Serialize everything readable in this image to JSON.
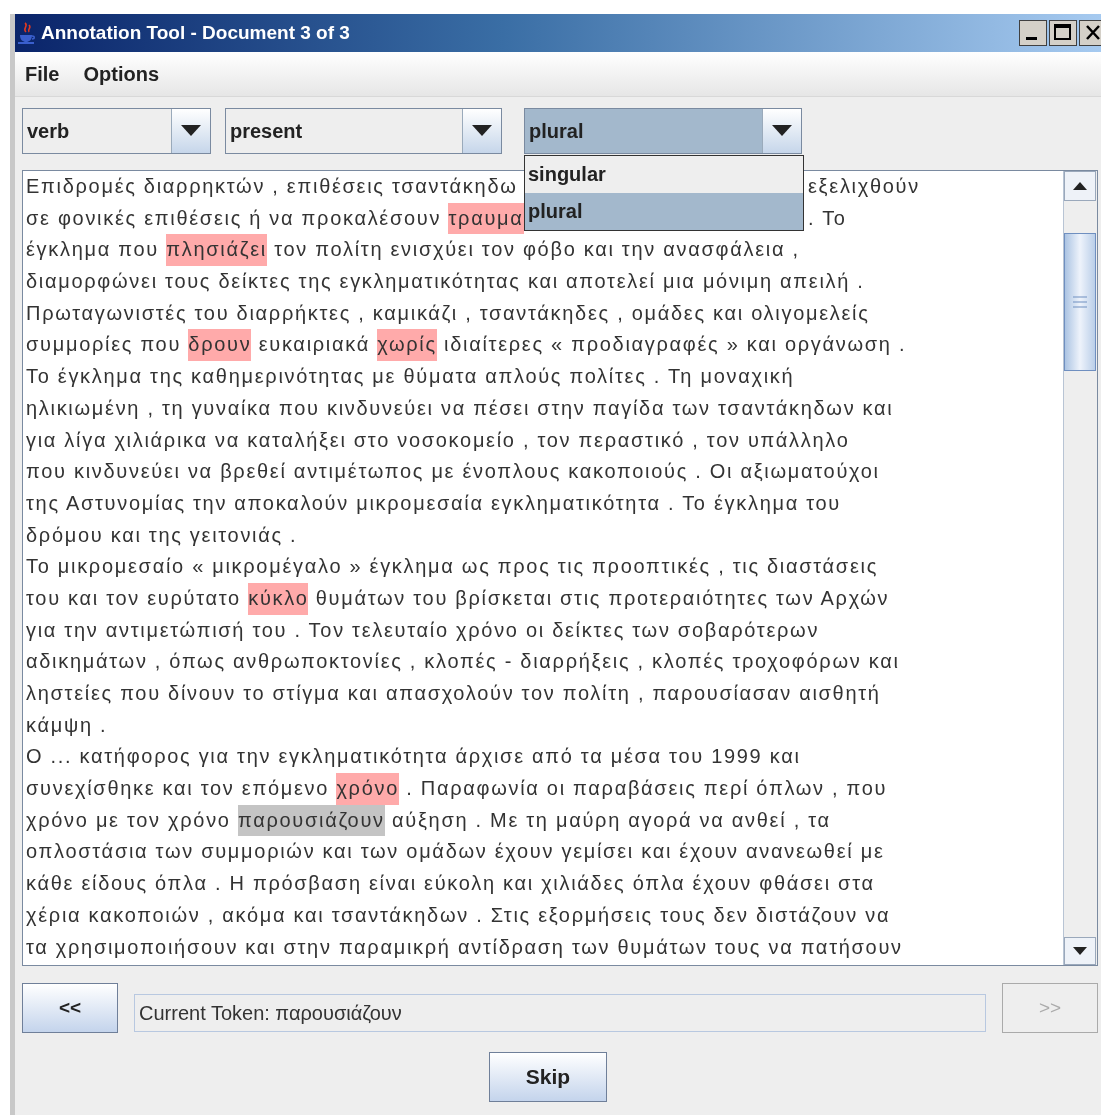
{
  "window": {
    "title": "Annotation Tool - Document 3 of 3"
  },
  "menu": [
    "File",
    "Options"
  ],
  "combos": [
    {
      "value": "verb",
      "open": false
    },
    {
      "value": "present",
      "open": false
    },
    {
      "value": "plural",
      "open": true,
      "options": [
        {
          "label": "singular",
          "selected": false
        },
        {
          "label": "plural",
          "selected": true
        }
      ]
    }
  ],
  "text_lines": [
    [
      "Επιδρομές διαρρηκτών , επιθέσεις τσαντάκηδω",
      {
        "kind": "covered"
      },
      "εξελιχθούν"
    ],
    [
      "σε φονικές επιθέσεις ή να προκαλέσουν ",
      {
        "text": "τραυμα",
        "current": false
      },
      {
        "kind": "covered"
      },
      ". Το"
    ],
    [
      "έγκλημα που ",
      {
        "text": "πλησιάζει",
        "current": false
      },
      " τον πολίτη ενισχύει τον φόβο και την ανασφάλεια ,"
    ],
    [
      "διαμορφώνει τους δείκτες της εγκληματικότητας και αποτελεί μια μόνιμη απειλή ."
    ],
    [
      "Πρωταγωνιστές του διαρρήκτες , καμικάζι , τσαντάκηδες , ομάδες και ολιγομελείς"
    ],
    [
      "συμμορίες που ",
      {
        "text": "δρουν",
        "current": false
      },
      " ευκαιριακά ",
      {
        "text": "χωρίς",
        "current": false
      },
      " ιδιαίτερες « προδιαγραφές » και οργάνωση ."
    ],
    [
      "Το έγκλημα της καθημερινότητας με θύματα απλούς πολίτες . Τη μοναχική"
    ],
    [
      "ηλικιωμένη , τη γυναίκα που κινδυνεύει να πέσει στην παγίδα των τσαντάκηδων και"
    ],
    [
      "για λίγα χιλιάρικα να καταλήξει στο νοσοκομείο , τον περαστικό , τον υπάλληλο"
    ],
    [
      "που κινδυνεύει να βρεθεί αντιμέτωπος με ένοπλους κακοποιούς . Οι αξιωματούχοι"
    ],
    [
      "της Αστυνομίας την αποκαλούν μικρομεσαία εγκληματικότητα . Το έγκλημα του"
    ],
    [
      "δρόμου και της γειτονιάς ."
    ],
    [
      "Το μικρομεσαίο « μικρομέγαλο » έγκλημα ως προς τις προοπτικές , τις διαστάσεις"
    ],
    [
      "του και τον ευρύτατο ",
      {
        "text": "κύκλο",
        "current": false
      },
      " θυμάτων του βρίσκεται στις προτεραιότητες των Αρχών"
    ],
    [
      "για την αντιμετώπισή του . Τον τελευταίο χρόνο οι δείκτες των σοβαρότερων"
    ],
    [
      "αδικημάτων , όπως ανθρωποκτονίες , κλοπές - διαρρήξεις , κλοπές τροχοφόρων και"
    ],
    [
      "ληστείες που δίνουν το στίγμα και απασχολούν τον πολίτη , παρουσίασαν αισθητή"
    ],
    [
      "κάμψη ."
    ],
    [
      "Ο ... κατήφορος για την εγκληματικότητα άρχισε από τα μέσα του 1999 και"
    ],
    [
      "συνεχίσθηκε και τον επόμενο ",
      {
        "text": "χρόνο",
        "current": false
      },
      " . Παραφωνία οι παραβάσεις περί όπλων , που"
    ],
    [
      "χρόνο με τον χρόνο ",
      {
        "text": "παρουσιάζουν",
        "current": true
      },
      " αύξηση . Με τη μαύρη αγορά να ανθεί , τα"
    ],
    [
      "οπλοστάσια των συμμοριών και των ομάδων έχουν γεμίσει και έχουν ανανεωθεί με"
    ],
    [
      "κάθε είδους όπλα . Η πρόσβαση είναι εύκολη και χιλιάδες όπλα έχουν φθάσει στα"
    ],
    [
      "χέρια κακοποιών , ακόμα και τσαντάκηδων . Στις εξορμήσεις τους δεν διστάζουν να"
    ],
    [
      "τα χρησιμοποιήσουν και στην παραμικρή αντίδραση των θυμάτων τους να πατήσουν"
    ]
  ],
  "prev_button": {
    "label": "<<",
    "disabled": false
  },
  "token_field": {
    "value": "Current Token: παρουσιάζουν"
  },
  "next_button": {
    "label": ">>",
    "disabled": true
  },
  "skip_button": {
    "label": "Skip",
    "disabled": false
  }
}
